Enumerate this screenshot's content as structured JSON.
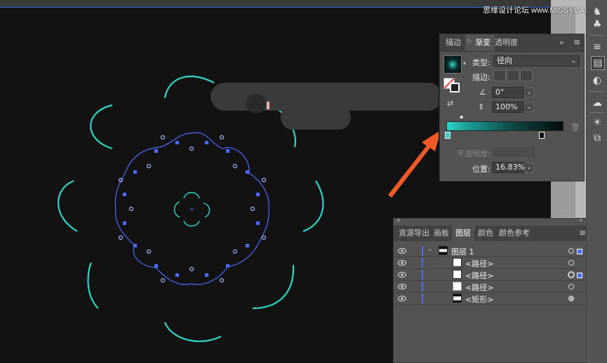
{
  "watermark": "思缘设计论坛 www.MISSYUAN.COM",
  "gradient_panel": {
    "tabs": [
      "描边",
      "渐变",
      "透明度"
    ],
    "active_tab": "渐变",
    "type_label": "类型:",
    "type_value": "径向",
    "stroke_label": "描边:",
    "angle_value": "0°",
    "aspect_value": "100%",
    "opacity_label": "不透明度:",
    "location_label": "位置:",
    "location_value": "16.83%",
    "colors": {
      "start": "#2fd6c8",
      "end": "#050b0c"
    }
  },
  "layers_panel": {
    "tabs": [
      "资源导出",
      "画板",
      "图层",
      "颜色",
      "颜色参考"
    ],
    "active_tab": "图层",
    "layers": [
      {
        "name": "图层 1"
      },
      {
        "name": "<路径>"
      },
      {
        "name": "<路径>"
      },
      {
        "name": "<路径>"
      },
      {
        "name": "<矩形>"
      }
    ]
  },
  "colors": {
    "accent": "#2a6fd6",
    "teal": "#2fd6c8",
    "arrow": "#f05a28",
    "selection": "#4b6dff"
  }
}
